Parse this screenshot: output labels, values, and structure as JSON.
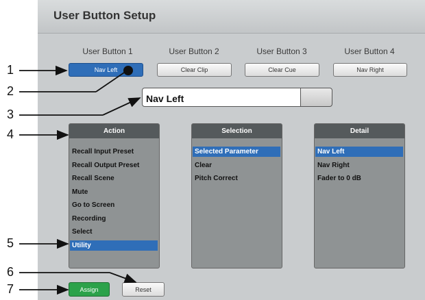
{
  "window": {
    "title": "User Button Setup"
  },
  "user_buttons": [
    {
      "label": "User Button 1",
      "value": "Nav Left",
      "active": true
    },
    {
      "label": "User Button 2",
      "value": "Clear Clip",
      "active": false
    },
    {
      "label": "User Button 3",
      "value": "Clear Cue",
      "active": false
    },
    {
      "label": "User Button 4",
      "value": "Nav Right",
      "active": false
    }
  ],
  "name_field": {
    "value": "Nav Left"
  },
  "action": {
    "header": "Action",
    "items": [
      "Recall Input Preset",
      "Recall Output Preset",
      "Recall Scene",
      "Mute",
      "Go to Screen",
      "Recording",
      "Select",
      "Utility"
    ],
    "selected": "Utility"
  },
  "selection": {
    "header": "Selection",
    "items": [
      "Selected Parameter",
      "Clear",
      "Pitch Correct"
    ],
    "selected": "Selected Parameter"
  },
  "detail": {
    "header": "Detail",
    "items": [
      "Nav Left",
      "Nav Right",
      "Fader to 0 dB"
    ],
    "selected": "Nav Left"
  },
  "buttons": {
    "assign": "Assign",
    "reset": "Reset"
  },
  "callouts": [
    "1",
    "2",
    "3",
    "4",
    "5",
    "6",
    "7"
  ],
  "colors": {
    "selected": "#2f6eb8",
    "assign": "#2ca24a",
    "panel": "#c9ccce",
    "list_bg": "#8f9394",
    "list_header": "#555a5c"
  }
}
